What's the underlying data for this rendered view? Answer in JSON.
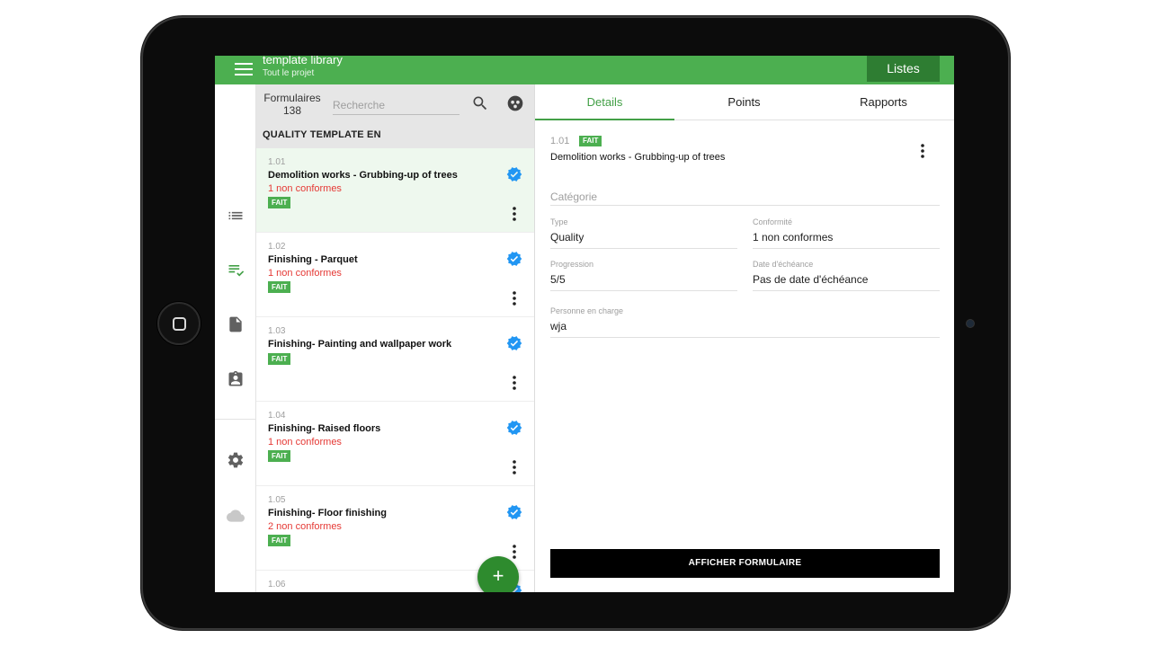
{
  "app": {
    "title": "template library",
    "subtitle": "Tout le projet",
    "listes_label": "Listes",
    "accent": "#4caf50",
    "accent_dark": "#2e7d32"
  },
  "rail": {
    "icons": [
      "list-icon",
      "checklist-icon",
      "document-icon",
      "clipboard-icon",
      "settings-icon",
      "cloud-icon"
    ]
  },
  "list": {
    "forms_label": "Formulaires",
    "forms_count": "138",
    "search_placeholder": "Recherche",
    "section_title": "QUALITY TEMPLATE EN",
    "items": [
      {
        "num": "1.01",
        "title": "Demolition works - Grubbing-up of trees",
        "nc": "1 non conformes",
        "badge": "FAIT"
      },
      {
        "num": "1.02",
        "title": "Finishing - Parquet",
        "nc": "1 non conformes",
        "badge": "FAIT"
      },
      {
        "num": "1.03",
        "title": "Finishing- Painting and wallpaper work",
        "nc": "",
        "badge": "FAIT"
      },
      {
        "num": "1.04",
        "title": "Finishing- Raised floors",
        "nc": "1 non conformes",
        "badge": "FAIT"
      },
      {
        "num": "1.05",
        "title": "Finishing- Floor finishing",
        "nc": "2 non conformes",
        "badge": "FAIT"
      },
      {
        "num": "1.06",
        "title": "",
        "nc": "",
        "badge": ""
      }
    ],
    "fab_label": "+"
  },
  "detail": {
    "tabs": [
      "Details",
      "Points",
      "Rapports"
    ],
    "num": "1.01",
    "badge": "FAIT",
    "title": "Demolition works - Grubbing-up of trees",
    "categorie_label": "Catégorie",
    "type_label": "Type",
    "type_value": "Quality",
    "conformite_label": "Conformité",
    "conformite_value": "1 non conformes",
    "progression_label": "Progression",
    "progression_value": "5/5",
    "echeance_label": "Date d'échéance",
    "echeance_value": "Pas de date d'échéance",
    "personne_label": "Personne en charge",
    "personne_value": "wja",
    "button_label": "AFFICHER FORMULAIRE"
  }
}
